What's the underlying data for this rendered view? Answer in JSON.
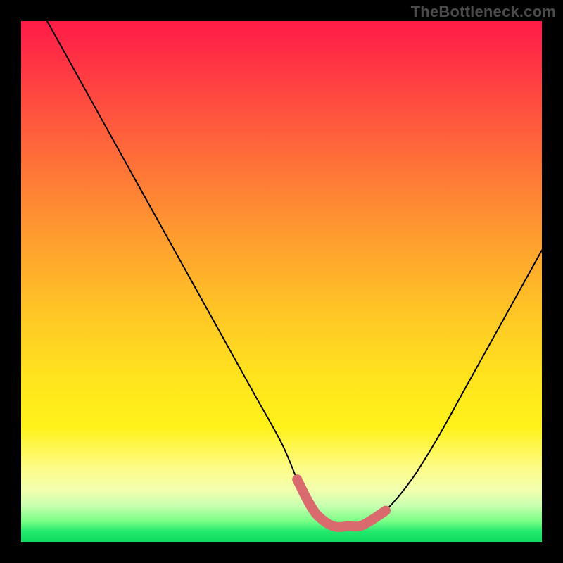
{
  "watermark": "TheBottleneck.com",
  "chart_data": {
    "type": "line",
    "title": "",
    "xlabel": "",
    "ylabel": "",
    "xlim": [
      0,
      100
    ],
    "ylim": [
      0,
      100
    ],
    "series": [
      {
        "name": "curve",
        "x": [
          5,
          10,
          15,
          20,
          25,
          30,
          35,
          40,
          45,
          50,
          53,
          55,
          57,
          60,
          63,
          65,
          67,
          70,
          75,
          80,
          85,
          90,
          95,
          100
        ],
        "values": [
          100,
          91,
          82,
          73,
          64,
          55,
          46,
          37,
          28,
          19,
          12,
          8,
          5,
          3,
          3,
          3,
          4,
          6,
          12,
          20,
          29,
          38,
          47,
          56
        ]
      }
    ],
    "highlight_range_x": [
      53,
      70
    ],
    "colors": {
      "curve": "#000000",
      "highlight": "#d96a6d",
      "gradient_top": "#ff1b47",
      "gradient_bottom": "#0edc61"
    }
  }
}
